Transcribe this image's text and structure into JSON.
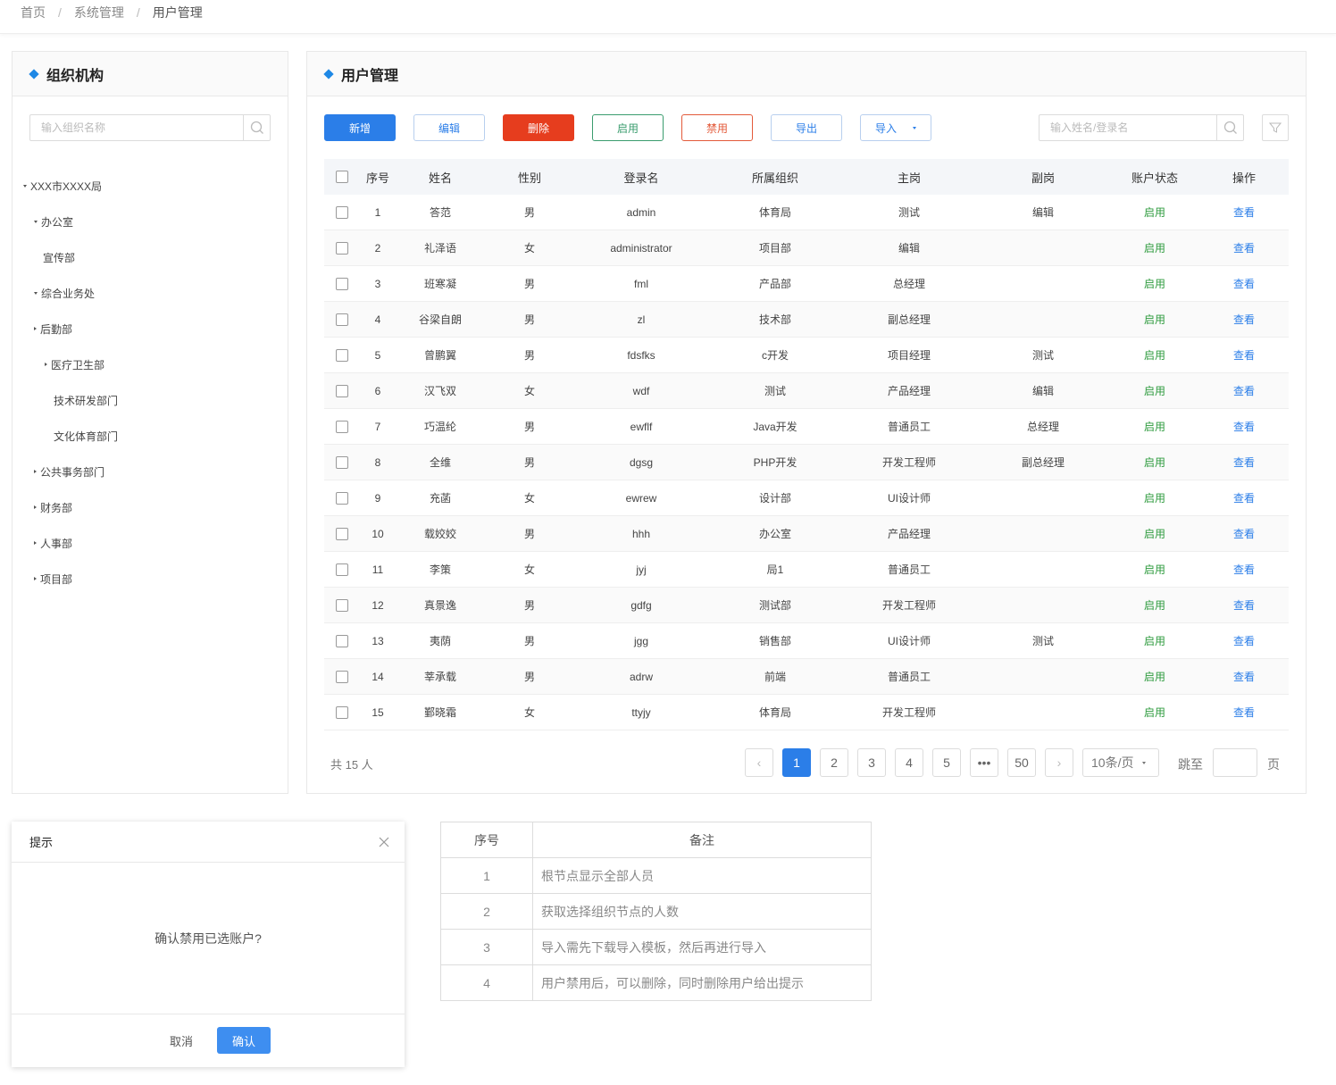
{
  "breadcrumb": {
    "home": "首页",
    "sep": "/",
    "system": "系统管理",
    "current": "用户管理"
  },
  "org_panel": {
    "title": "组织机构",
    "search_placeholder": "输入组织名称",
    "tree": [
      {
        "label": "XXX市XXXX局",
        "level": 0,
        "arrow": "down"
      },
      {
        "label": "办公室",
        "level": 1,
        "arrow": "down"
      },
      {
        "label": "宣传部",
        "level": 2,
        "arrow": "none"
      },
      {
        "label": "综合业务处",
        "level": 1,
        "arrow": "down"
      },
      {
        "label": "后勤部",
        "level": 1,
        "arrow": "right"
      },
      {
        "label": "医疗卫生部",
        "level": 2,
        "arrow": "right"
      },
      {
        "label": "技术研发部门",
        "level": 3,
        "arrow": "none"
      },
      {
        "label": "文化体育部门",
        "level": 3,
        "arrow": "none"
      },
      {
        "label": "公共事务部门",
        "level": 1,
        "arrow": "right"
      },
      {
        "label": "财务部",
        "level": 1,
        "arrow": "right"
      },
      {
        "label": "人事部",
        "level": 1,
        "arrow": "right"
      },
      {
        "label": "项目部",
        "level": 1,
        "arrow": "right"
      }
    ]
  },
  "user_panel": {
    "title": "用户管理",
    "toolbar": {
      "add": "新增",
      "edit": "编辑",
      "delete": "删除",
      "enable": "启用",
      "disable": "禁用",
      "export": "导出",
      "import": "导入"
    },
    "search_placeholder": "输入姓名/登录名",
    "columns": [
      "序号",
      "姓名",
      "性别",
      "登录名",
      "所属组织",
      "主岗",
      "副岗",
      "账户状态",
      "操作"
    ],
    "rows": [
      [
        "1",
        "答范",
        "男",
        "admin",
        "体育局",
        "测试",
        "编辑",
        "启用",
        "查看"
      ],
      [
        "2",
        "礼泽语",
        "女",
        "administrator",
        "项目部",
        "编辑",
        "",
        "启用",
        "查看"
      ],
      [
        "3",
        "班寒凝",
        "男",
        "fml",
        "产品部",
        "总经理",
        "",
        "启用",
        "查看"
      ],
      [
        "4",
        "谷梁自朗",
        "男",
        "zl",
        "技术部",
        "副总经理",
        "",
        "启用",
        "查看"
      ],
      [
        "5",
        "曾鹏翼",
        "男",
        "fdsfks",
        "c开发",
        "项目经理",
        "测试",
        "启用",
        "查看"
      ],
      [
        "6",
        "汉飞双",
        "女",
        "wdf",
        "测试",
        "产品经理",
        "编辑",
        "启用",
        "查看"
      ],
      [
        "7",
        "巧温纶",
        "男",
        "ewflf",
        "Java开发",
        "普通员工",
        "总经理",
        "启用",
        "查看"
      ],
      [
        "8",
        "全维",
        "男",
        "dgsg",
        "PHP开发",
        "开发工程师",
        "副总经理",
        "启用",
        "查看"
      ],
      [
        "9",
        "充菡",
        "女",
        "ewrew",
        "设计部",
        "UI设计师",
        "",
        "启用",
        "查看"
      ],
      [
        "10",
        "载姣姣",
        "男",
        "hhh",
        "办公室",
        "产品经理",
        "",
        "启用",
        "查看"
      ],
      [
        "11",
        "李策",
        "女",
        "jyj",
        "局1",
        "普通员工",
        "",
        "启用",
        "查看"
      ],
      [
        "12",
        "真景逸",
        "男",
        "gdfg",
        "测试部",
        "开发工程师",
        "",
        "启用",
        "查看"
      ],
      [
        "13",
        "夷荫",
        "男",
        "jgg",
        "销售部",
        "UI设计师",
        "测试",
        "启用",
        "查看"
      ],
      [
        "14",
        "莘承载",
        "男",
        "adrw",
        "前端",
        "普通员工",
        "",
        "启用",
        "查看"
      ],
      [
        "15",
        "鄞晓霜",
        "女",
        "ttyjy",
        "体育局",
        "开发工程师",
        "",
        "启用",
        "查看"
      ]
    ],
    "pagination": {
      "total_text": "共 15 人",
      "prev": "‹",
      "pages": [
        "1",
        "2",
        "3",
        "4",
        "5"
      ],
      "current": "1",
      "ellipsis": "•••",
      "last": "50",
      "next": "›",
      "page_size": "10条/页",
      "jump_label": "跳至",
      "page_suffix": "页"
    }
  },
  "dialog": {
    "title": "提示",
    "message": "确认禁用已选账户?",
    "cancel": "取消",
    "confirm": "确认"
  },
  "notes": {
    "headers": [
      "序号",
      "备注"
    ],
    "rows": [
      [
        "1",
        "根节点显示全部人员"
      ],
      [
        "2",
        "获取选择组织节点的人数"
      ],
      [
        "3",
        "导入需先下载导入模板，然后再进行导入"
      ],
      [
        "4",
        "用户禁用后，可以删除，同时删除用户给出提示"
      ]
    ]
  },
  "colors": {
    "primary": "#2b7ee8",
    "danger": "#e63d1e",
    "success": "#2e9b3e",
    "enable_outline": "#3a9c6e",
    "disable_outline": "#e35a3a"
  },
  "icons": {
    "search": "search-icon",
    "filter": "filter-icon",
    "close": "close-icon",
    "title_marker": "diamond-icon"
  }
}
